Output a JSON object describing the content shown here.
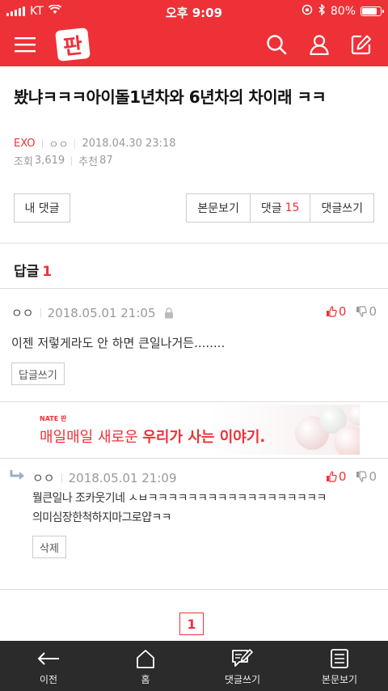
{
  "status_bar": {
    "carrier": "KT",
    "time": "오후 9:09",
    "battery": "80%",
    "battery_level": 0.8
  },
  "header": {
    "logo_text": "판",
    "icons": [
      "menu-icon",
      "search-icon",
      "user-icon",
      "edit-icon"
    ],
    "color": "#ee3137"
  },
  "article": {
    "title": "봤냐ㅋㅋㅋ아이돌1년차와 6년차의 차이래 ㅋㅋ",
    "category": "EXO",
    "author": "ㅇㅇ",
    "date": "2018.04.30 23:18",
    "views_label": "조회",
    "views": "3,619",
    "likes_label": "추천",
    "likes": "87"
  },
  "buttons": {
    "my_comments": "내 댓글",
    "view_body": "본문보기",
    "comments_label": "댓글",
    "comments_count": "15",
    "write_comment": "댓글쓰기"
  },
  "replies": {
    "heading": "답글",
    "count": "1"
  },
  "comment": {
    "author": "ㅇㅇ",
    "date": "2018.05.01 21:05",
    "up": "0",
    "down": "0",
    "text": "이젠 저렇게라도 안 하면 큰일나거든........",
    "reply_button": "답글쓰기"
  },
  "ad": {
    "brand": "NATE 판",
    "text_plain": "매일매일 새로운 ",
    "text_bold": "우리가 사는 이야기."
  },
  "reply": {
    "author": "ㅇㅇ",
    "date": "2018.05.01 21:09",
    "up": "0",
    "down": "0",
    "line1": "뭘큰일나 조카웃기네 ㅅㅂㅋㅋㅋㅋㅋㅋㅋㅋㅋㅋㅋㅋㅋㅋㅋㅋㅋㅋ",
    "line2": "의미심장한척하지마그로얍ㅋㅋ",
    "delete_button": "삭제"
  },
  "pagination": {
    "current": "1"
  },
  "bottom_nav": [
    {
      "label": "이전",
      "icon": "back-arrow-icon"
    },
    {
      "label": "홈",
      "icon": "home-icon"
    },
    {
      "label": "댓글쓰기",
      "icon": "write-comment-icon"
    },
    {
      "label": "본문보기",
      "icon": "document-icon"
    }
  ]
}
